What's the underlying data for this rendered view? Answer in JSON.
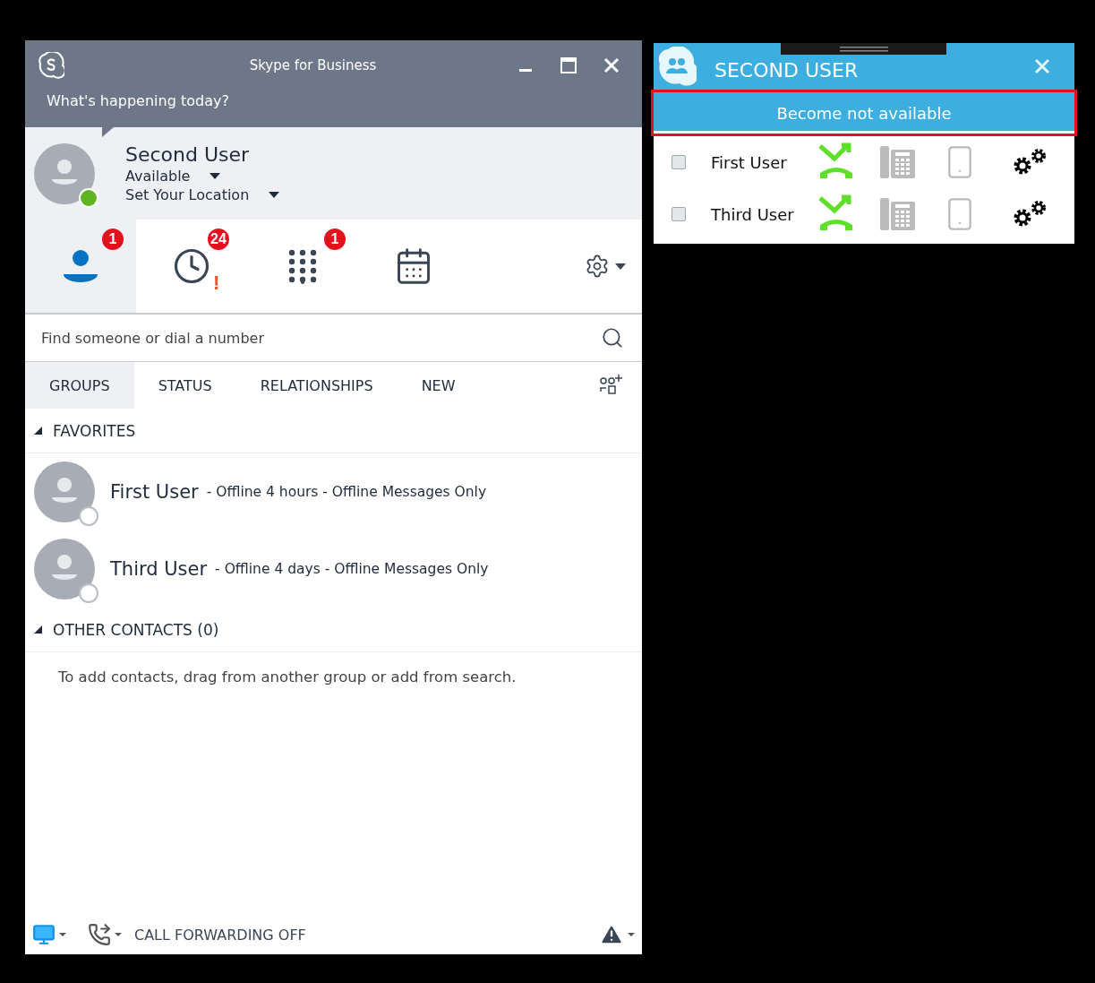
{
  "main_window": {
    "title": "Skype for Business",
    "status_prompt": "What's happening today?",
    "profile": {
      "name": "Second User",
      "availability": "Available",
      "location": "Set Your Location",
      "color": "#5eb524"
    },
    "nav_tabs": [
      {
        "kind": "contacts",
        "badge": "1",
        "selected": true
      },
      {
        "kind": "history",
        "badge": "24",
        "alert": "!",
        "selected": false
      },
      {
        "kind": "dialpad",
        "badge": "1",
        "selected": false
      },
      {
        "kind": "meetings",
        "selected": false
      }
    ],
    "search": {
      "placeholder": "Find someone or dial a number"
    },
    "view_tabs": [
      {
        "label": "GROUPS",
        "selected": true
      },
      {
        "label": "STATUS",
        "selected": false
      },
      {
        "label": "RELATIONSHIPS",
        "selected": false
      },
      {
        "label": "NEW",
        "selected": false
      }
    ],
    "groups": [
      {
        "name": "FAVORITES",
        "expanded": true,
        "contacts": [
          {
            "name": "First User",
            "note": "- Offline 4 hours - Offline Messages Only",
            "color": "#ffffff"
          },
          {
            "name": "Third User",
            "note": "- Offline 4 days - Offline Messages Only",
            "color": "#ffffff"
          }
        ]
      },
      {
        "name": "OTHER CONTACTS (0)",
        "expanded": true,
        "empty_message": "To add contacts, drag from another group or add from search."
      }
    ],
    "status_bar": {
      "call_forwarding": "CALL FORWARDING OFF"
    }
  },
  "side_panel": {
    "title": "SECOND USER",
    "action": {
      "label": "Become not available",
      "highlighted": true
    },
    "users": [
      {
        "name": "First User",
        "checked": false
      },
      {
        "name": "Third User",
        "checked": false
      }
    ]
  }
}
